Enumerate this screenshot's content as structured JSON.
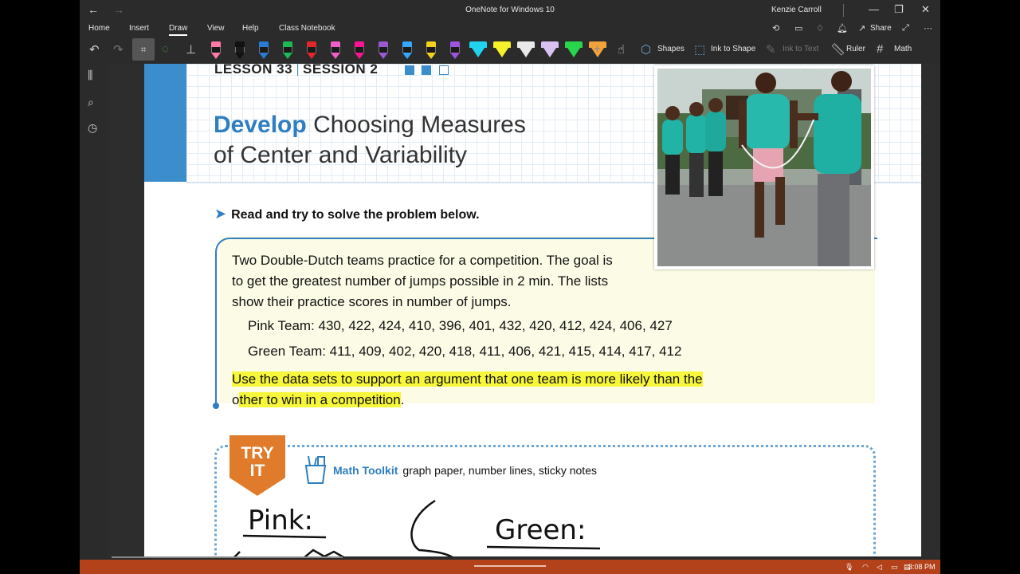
{
  "window": {
    "title": "OneNote for Windows 10",
    "user": "Kenzie Carroll"
  },
  "tabs": [
    "Home",
    "Insert",
    "Draw",
    "View",
    "Help",
    "Class Notebook"
  ],
  "active_tab": "Draw",
  "tab_actions": {
    "share": "Share"
  },
  "toolbar": {
    "shapes": "Shapes",
    "ink_to_shape": "Ink to Shape",
    "ink_to_text": "Ink to Text",
    "ruler": "Ruler",
    "math": "Math",
    "pen_colors": [
      "#ff7aa8",
      "#111111",
      "#2a7bd6",
      "#1db954",
      "#e3262c",
      "#f05fc8",
      "#ff1493",
      "#9b59d0",
      "#36a6ff",
      "#f3d21c",
      "#9d55e0"
    ],
    "highlighter_colors": [
      "#22d3f0",
      "#f5f12a",
      "#e9e9e9",
      "#d9c2f2",
      "#29d64b",
      "#f2a23a"
    ]
  },
  "page": {
    "lesson": "LESSON 33",
    "session": "SESSION 2",
    "title_bold": "Develop",
    "title_rest_line1": "Choosing Measures",
    "title_line2": "of Center and Variability",
    "instruction": "Read and try to solve the problem below.",
    "problem_lines": [
      "Two Double-Dutch teams practice for a competition. The goal is",
      "to get the greatest number of jumps possible in 2 min. The lists",
      "show their practice scores in number of jumps."
    ],
    "pink_team": "Pink Team: 430,  422,  424,  410,  396,  401,  432,  420,  412,  424,  406,  427",
    "green_team": "Green Team: 411,  409,  402,  420,  418,  411,  406,  421,  415,  414,  417,  412",
    "highlight_line1": "Use the data sets to support an argument that one team is more likely than the",
    "highlight_line2a": "o",
    "highlight_line2b": "ther to win in a competition",
    "highlight_line2c": ".",
    "try_it": [
      "TRY",
      "IT"
    ],
    "toolkit_label": "Math Toolkit",
    "toolkit_items": "graph paper, number lines, sticky notes",
    "ink_pink": "Pink:",
    "ink_green": "Green:"
  },
  "taskbar": {
    "time": "3:08 PM"
  }
}
